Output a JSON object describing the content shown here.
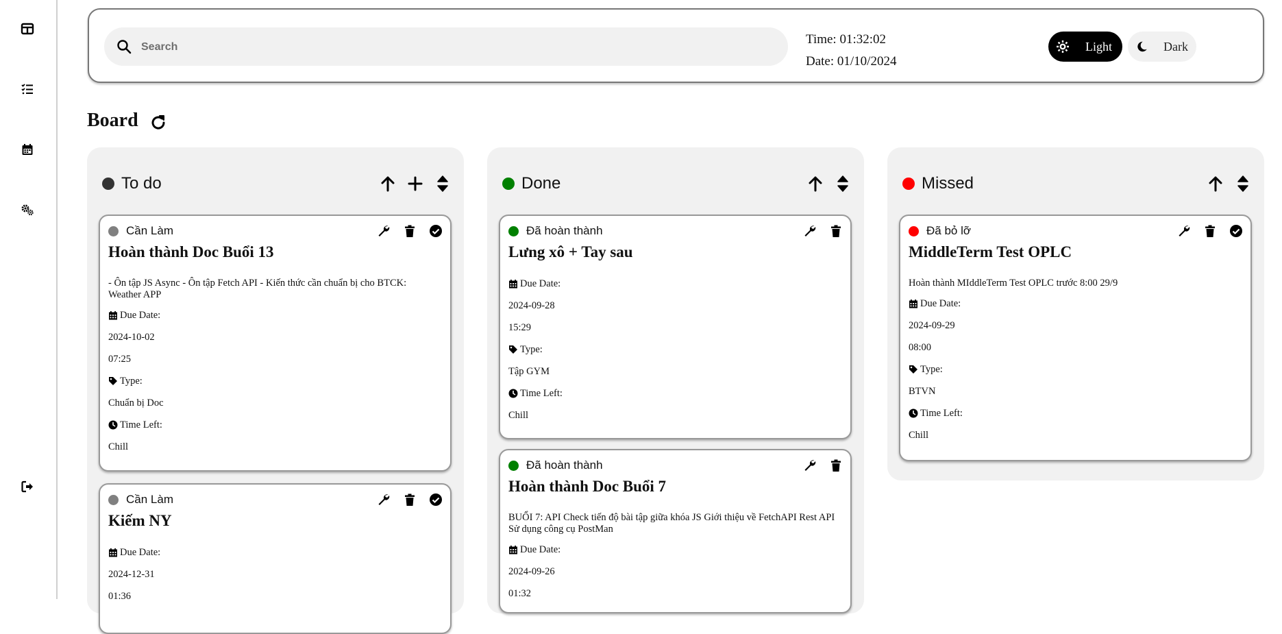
{
  "search": {
    "placeholder": "Search",
    "value": ""
  },
  "clock": {
    "time": "Time: 01:32:02",
    "date": "Date: 01/10/2024"
  },
  "theme": {
    "light_label": "Light",
    "dark_label": "Dark"
  },
  "board": {
    "title": "Board"
  },
  "field_labels": {
    "due_date": "Due Date:",
    "type": "Type:",
    "time_left": "Time Left:"
  },
  "colors": {
    "todo": "#333333",
    "done": "#008000",
    "missed": "#ff0000",
    "pending": "#808080"
  },
  "columns": [
    {
      "title": "To do",
      "cards": [
        {
          "status": "Cần Làm",
          "title": "Hoàn thành Doc Buổi 13",
          "description": "- Ôn tập JS Async - Ôn tập Fetch API - Kiến thức cần chuẩn bị cho BTCK: Weather APP",
          "due_date": "2024-10-02",
          "due_time": "07:25",
          "type": "Chuẩn bị Doc",
          "time_left": "Chill"
        },
        {
          "status": "Cần Làm",
          "title": "Kiếm NY",
          "due_date": "2024-12-31",
          "due_time": "01:36"
        }
      ]
    },
    {
      "title": "Done",
      "cards": [
        {
          "status": "Đã hoàn thành",
          "title": "Lưng xô + Tay sau",
          "due_date": "2024-09-28",
          "due_time": "15:29",
          "type": "Tập GYM",
          "time_left": "Chill"
        },
        {
          "status": "Đã hoàn thành",
          "title": "Hoàn thành Doc Buổi 7",
          "description": "BUỔI 7: API Check tiến độ bài tập giữa khóa JS Giới thiệu về FetchAPI Rest API Sử dụng công cụ PostMan",
          "due_date": "2024-09-26",
          "due_time": "01:32"
        }
      ]
    },
    {
      "title": "Missed",
      "cards": [
        {
          "status": "Đã bỏ lỡ",
          "title": "MiddleTerm Test OPLC",
          "description": "Hoàn thành MIddleTerm Test OPLC trước 8:00 29/9",
          "due_date": "2024-09-29",
          "due_time": "08:00",
          "type": "BTVN",
          "time_left": "Chill"
        }
      ]
    }
  ]
}
